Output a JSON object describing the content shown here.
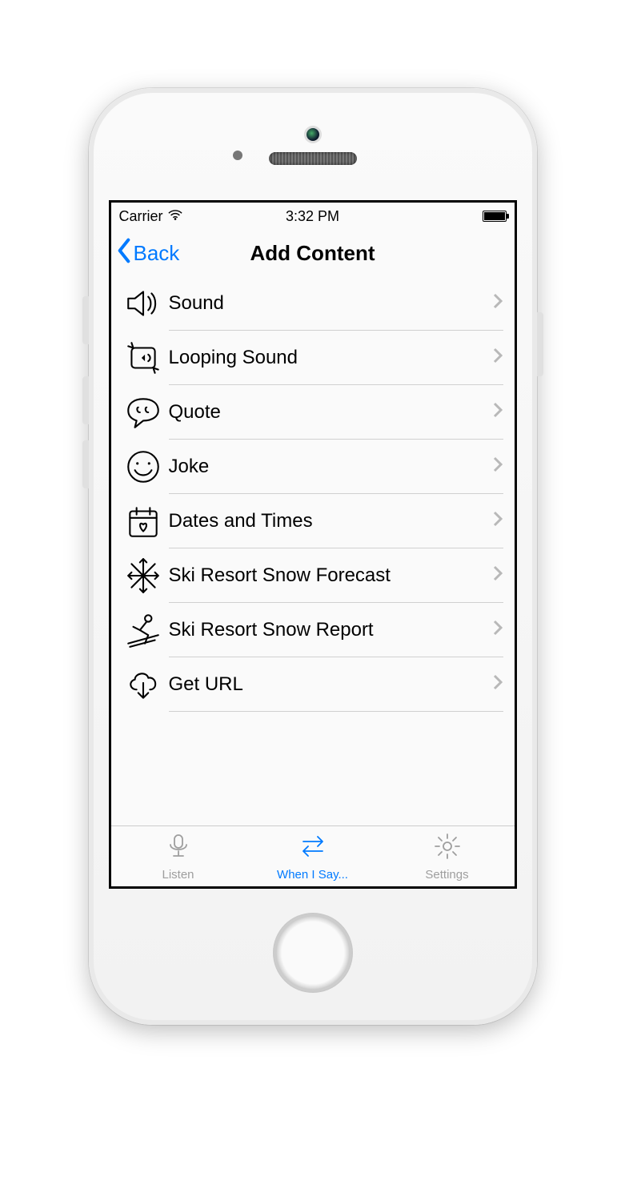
{
  "status": {
    "carrier": "Carrier",
    "time": "3:32 PM"
  },
  "navbar": {
    "back": "Back",
    "title": "Add Content"
  },
  "list": {
    "items": [
      {
        "label": "Sound"
      },
      {
        "label": "Looping Sound"
      },
      {
        "label": "Quote"
      },
      {
        "label": "Joke"
      },
      {
        "label": "Dates and Times"
      },
      {
        "label": "Ski Resort Snow Forecast"
      },
      {
        "label": "Ski Resort Snow Report"
      },
      {
        "label": "Get URL"
      }
    ]
  },
  "tabs": {
    "listen": {
      "label": "Listen"
    },
    "whenisay": {
      "label": "When I Say..."
    },
    "settings": {
      "label": "Settings"
    }
  }
}
